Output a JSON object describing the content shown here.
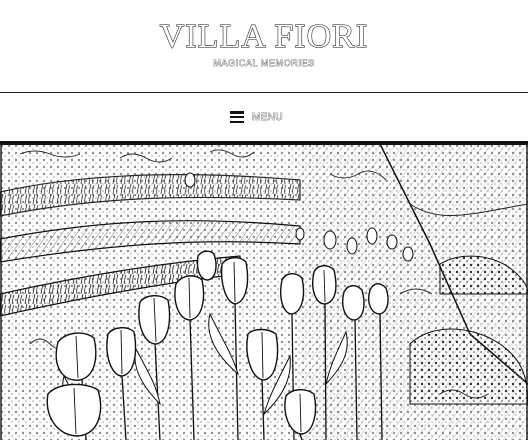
{
  "site": {
    "title": "VILLA FIORI",
    "tagline": "MAGICAL MEMORIES"
  },
  "nav": {
    "menu_label": "MENU",
    "menu_icon": "hamburger-icon"
  },
  "hero": {
    "style": "pencil-sketch",
    "subject": "tulip garden"
  }
}
